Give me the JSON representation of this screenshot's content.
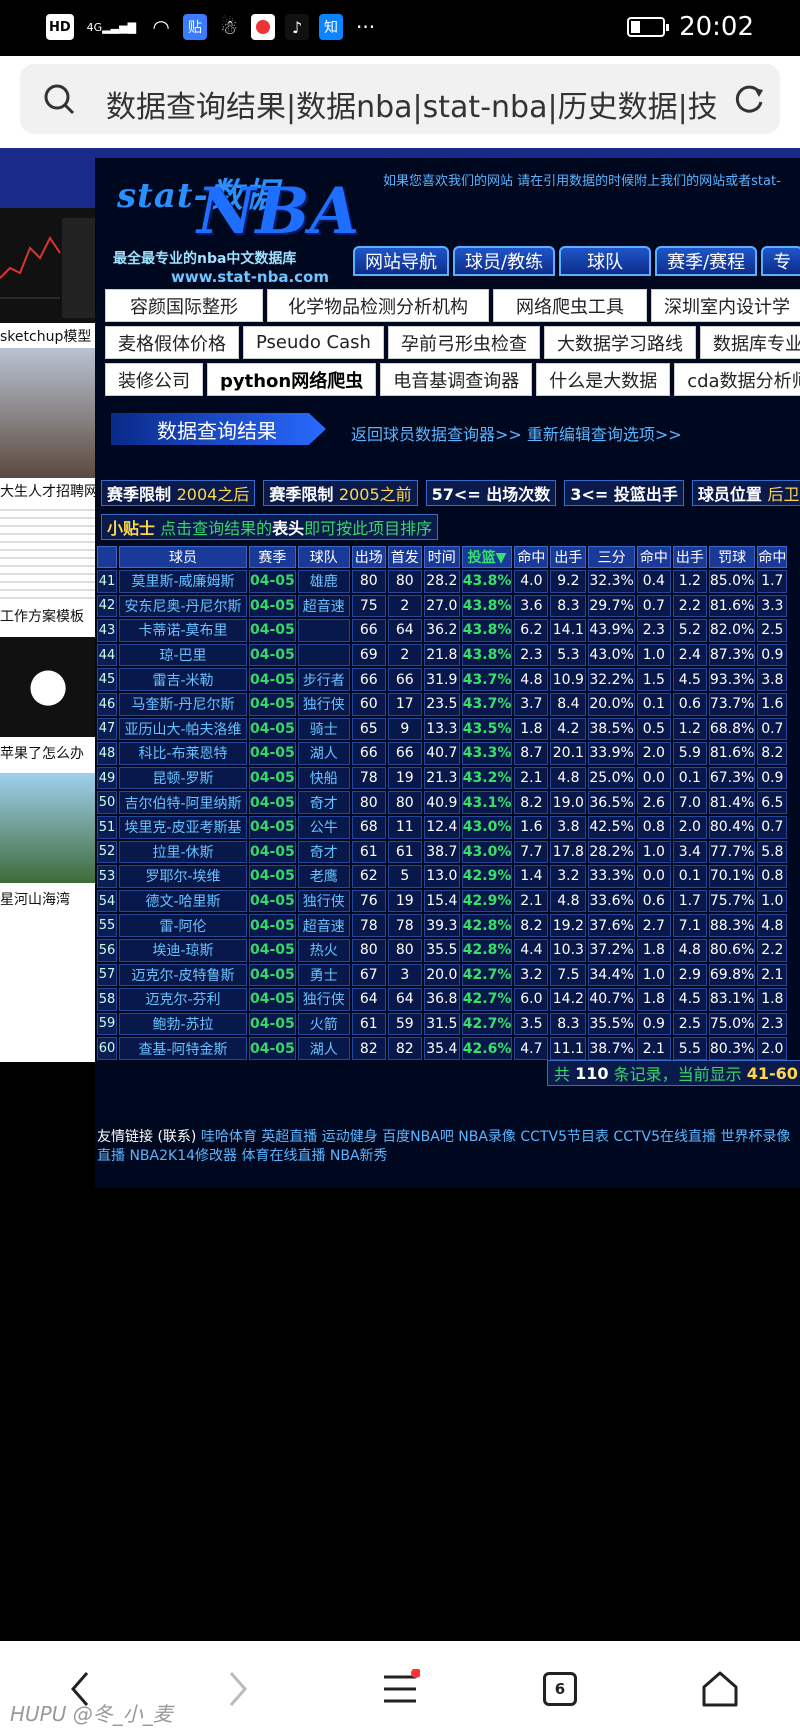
{
  "status_bar": {
    "icons": [
      "HD",
      "4G",
      "贴",
      "知"
    ],
    "time": "20:02"
  },
  "url_bar": {
    "text": "数据查询结果|数据nba|stat-nba|历史数据|技"
  },
  "ads": [
    {
      "caption": "sketchup模型"
    },
    {
      "caption": "大生人才招聘网"
    },
    {
      "caption": "工作方案模板"
    },
    {
      "caption": "苹果了怎么办"
    },
    {
      "caption": "星河山海湾"
    }
  ],
  "site": {
    "logo": {
      "script": "stat-数据",
      "nba": "NBA",
      "tagline": "最全最专业的nba中文数据库",
      "url": "www.stat-nba.com"
    },
    "marquee": "如果您喜欢我们的网站 请在引用数据的时候附上我们的网站或者stat-",
    "nav": [
      "网站导航",
      "球员/教练",
      "球队",
      "赛季/赛程",
      "专"
    ],
    "ad_rows": [
      [
        "容颜国际整形",
        "化学物品检测分析机构",
        "网络爬虫工具",
        "深圳室内设计学"
      ],
      [
        "麦格假体价格",
        "Pseudo Cash",
        "孕前弓形虫检查",
        "大数据学习路线",
        "数据库专业"
      ],
      [
        "装修公司",
        "python网络爬虫",
        "电音基调查询器",
        "什么是大数据",
        "cda数据分析师"
      ]
    ],
    "result_title": "数据查询结果",
    "back_links": "返回球员数据查询器>> 重新编辑查询选项>>",
    "filters": [
      {
        "label": "赛季限制",
        "value": "2004之后"
      },
      {
        "label": "赛季限制",
        "value": "2005之前"
      },
      {
        "label": "57<= 出场次数",
        "value": ""
      },
      {
        "label": "3<= 投篮出手",
        "value": ""
      },
      {
        "label": "球员位置",
        "value": "后卫(包"
      }
    ],
    "tip": {
      "label": "小贴士",
      "pre": "点击查询结果的",
      "bold": "表头",
      "post": "即可按此项目排序"
    },
    "table": {
      "headers": [
        "",
        "球员",
        "赛季",
        "球队",
        "出场",
        "首发",
        "时间",
        "投篮▼",
        "命中",
        "出手",
        "三分",
        "命中",
        "出手",
        "罚球",
        "命中"
      ],
      "rows": [
        [
          "41",
          "莫里斯-威廉姆斯",
          "04-05",
          "雄鹿",
          "80",
          "80",
          "28.2",
          "43.8%",
          "4.0",
          "9.2",
          "32.3%",
          "0.4",
          "1.2",
          "85.0%",
          "1.7"
        ],
        [
          "42",
          "安东尼奥-丹尼尔斯",
          "04-05",
          "超音速",
          "75",
          "2",
          "27.0",
          "43.8%",
          "3.6",
          "8.3",
          "29.7%",
          "0.7",
          "2.2",
          "81.6%",
          "3.3"
        ],
        [
          "43",
          "卡蒂诺-莫布里",
          "04-05",
          "",
          "66",
          "64",
          "36.2",
          "43.8%",
          "6.2",
          "14.1",
          "43.9%",
          "2.3",
          "5.2",
          "82.0%",
          "2.5"
        ],
        [
          "44",
          "琼-巴里",
          "04-05",
          "",
          "69",
          "2",
          "21.8",
          "43.8%",
          "2.3",
          "5.3",
          "43.0%",
          "1.0",
          "2.4",
          "87.3%",
          "0.9"
        ],
        [
          "45",
          "雷吉-米勒",
          "04-05",
          "步行者",
          "66",
          "66",
          "31.9",
          "43.7%",
          "4.8",
          "10.9",
          "32.2%",
          "1.5",
          "4.5",
          "93.3%",
          "3.8"
        ],
        [
          "46",
          "马奎斯-丹尼尔斯",
          "04-05",
          "独行侠",
          "60",
          "17",
          "23.5",
          "43.7%",
          "3.7",
          "8.4",
          "20.0%",
          "0.1",
          "0.6",
          "73.7%",
          "1.6"
        ],
        [
          "47",
          "亚历山大-帕夫洛维",
          "04-05",
          "骑士",
          "65",
          "9",
          "13.3",
          "43.5%",
          "1.8",
          "4.2",
          "38.5%",
          "0.5",
          "1.2",
          "68.8%",
          "0.7"
        ],
        [
          "48",
          "科比-布莱恩特",
          "04-05",
          "湖人",
          "66",
          "66",
          "40.7",
          "43.3%",
          "8.7",
          "20.1",
          "33.9%",
          "2.0",
          "5.9",
          "81.6%",
          "8.2"
        ],
        [
          "49",
          "昆顿-罗斯",
          "04-05",
          "快船",
          "78",
          "19",
          "21.3",
          "43.2%",
          "2.1",
          "4.8",
          "25.0%",
          "0.0",
          "0.1",
          "67.3%",
          "0.9"
        ],
        [
          "50",
          "吉尔伯特-阿里纳斯",
          "04-05",
          "奇才",
          "80",
          "80",
          "40.9",
          "43.1%",
          "8.2",
          "19.0",
          "36.5%",
          "2.6",
          "7.0",
          "81.4%",
          "6.5"
        ],
        [
          "51",
          "埃里克-皮亚考斯基",
          "04-05",
          "公牛",
          "68",
          "11",
          "12.4",
          "43.0%",
          "1.6",
          "3.8",
          "42.5%",
          "0.8",
          "2.0",
          "80.4%",
          "0.7"
        ],
        [
          "52",
          "拉里-休斯",
          "04-05",
          "奇才",
          "61",
          "61",
          "38.7",
          "43.0%",
          "7.7",
          "17.8",
          "28.2%",
          "1.0",
          "3.4",
          "77.7%",
          "5.8"
        ],
        [
          "53",
          "罗耶尔-埃维",
          "04-05",
          "老鹰",
          "62",
          "5",
          "13.0",
          "42.9%",
          "1.4",
          "3.2",
          "33.3%",
          "0.0",
          "0.1",
          "70.1%",
          "0.8"
        ],
        [
          "54",
          "德文-哈里斯",
          "04-05",
          "独行侠",
          "76",
          "19",
          "15.4",
          "42.9%",
          "2.1",
          "4.8",
          "33.6%",
          "0.6",
          "1.7",
          "75.7%",
          "1.0"
        ],
        [
          "55",
          "雷-阿伦",
          "04-05",
          "超音速",
          "78",
          "78",
          "39.3",
          "42.8%",
          "8.2",
          "19.2",
          "37.6%",
          "2.7",
          "7.1",
          "88.3%",
          "4.8"
        ],
        [
          "56",
          "埃迪-琼斯",
          "04-05",
          "热火",
          "80",
          "80",
          "35.5",
          "42.8%",
          "4.4",
          "10.3",
          "37.2%",
          "1.8",
          "4.8",
          "80.6%",
          "2.2"
        ],
        [
          "57",
          "迈克尔-皮特鲁斯",
          "04-05",
          "勇士",
          "67",
          "3",
          "20.0",
          "42.7%",
          "3.2",
          "7.5",
          "34.4%",
          "1.0",
          "2.9",
          "69.8%",
          "2.1"
        ],
        [
          "58",
          "迈克尔-芬利",
          "04-05",
          "独行侠",
          "64",
          "64",
          "36.8",
          "42.7%",
          "6.0",
          "14.2",
          "40.7%",
          "1.8",
          "4.5",
          "83.1%",
          "1.8"
        ],
        [
          "59",
          "鲍勃-苏拉",
          "04-05",
          "火箭",
          "61",
          "59",
          "31.5",
          "42.7%",
          "3.5",
          "8.3",
          "35.5%",
          "0.9",
          "2.5",
          "75.0%",
          "2.3"
        ],
        [
          "60",
          "查基-阿特金斯",
          "04-05",
          "湖人",
          "82",
          "82",
          "35.4",
          "42.6%",
          "4.7",
          "11.1",
          "38.7%",
          "2.1",
          "5.5",
          "80.3%",
          "2.0"
        ]
      ]
    },
    "pager": {
      "pre": "共",
      "total": "110",
      "mid": "条记录，当前显示",
      "range": "41-60",
      "post": "条"
    },
    "friends": {
      "label": "友情链接 (联系)",
      "links": "哇哈体育 英超直播 运动健身 百度NBA吧 NBA录像 CCTV5节目表 CCTV5在线直播 世界杯录像 直播 NBA2K14修改器 体育在线直播 NBA新秀"
    }
  },
  "nav_bar": {
    "tabs_count": "6",
    "watermark": "HUPU @冬_小_麦"
  }
}
